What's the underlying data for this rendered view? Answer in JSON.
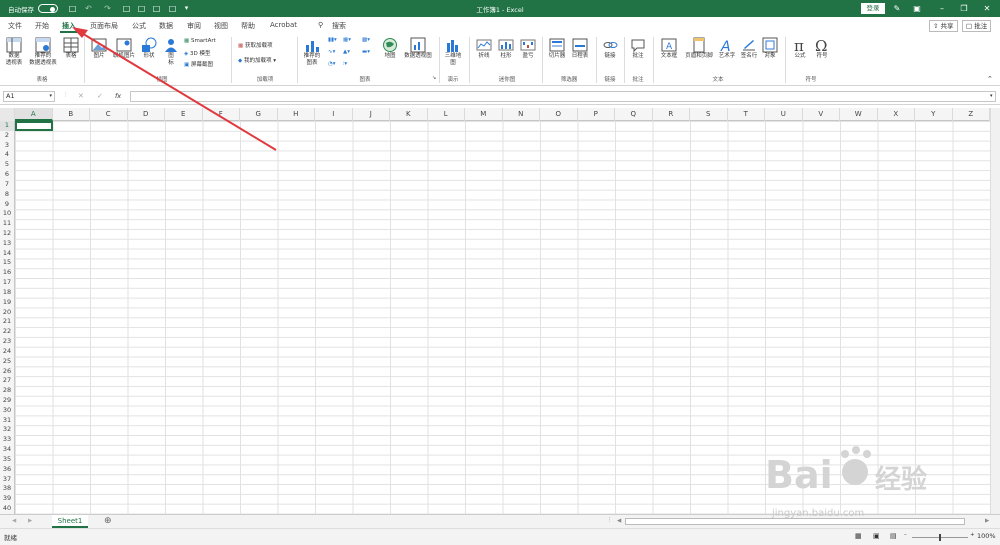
{
  "titlebar": {
    "autosave_label": "自动保存",
    "doc_title": "工作簿1 - Excel",
    "login": "登录"
  },
  "tabs": [
    "文件",
    "开始",
    "插入",
    "页面布局",
    "公式",
    "数据",
    "审阅",
    "视图",
    "帮助",
    "Acrobat",
    "搜索"
  ],
  "share": {
    "share": "共享",
    "comment": "批注"
  },
  "ribbon": {
    "pivot": "数据\n透视表",
    "rec_pivot": "推荐的\n数据透视表",
    "table": "表格",
    "grp_table": "表格",
    "picture": "图片",
    "online_picture": "联机图片",
    "shapes": "形状",
    "icons": "图\n标",
    "smartart": "SmartArt",
    "model3d": "3D 模型",
    "screenshot": "屏幕截图",
    "grp_illus": "插图",
    "get_addins": "获取加载项",
    "my_addins": "我的加载项",
    "grp_addins": "加载项",
    "rec_charts": "推荐的\n图表",
    "maps": "地图",
    "pivotchart": "数据透视图",
    "grp_charts": "图表",
    "map3d": "三维地\n图",
    "grp_tours": "演示",
    "line": "折线",
    "column": "柱形",
    "winloss": "盈亏",
    "grp_spark": "迷你图",
    "slicer": "切片器",
    "timeline": "日程表",
    "grp_filter": "筛选器",
    "link": "链接",
    "grp_link": "链接",
    "comment": "批注",
    "grp_comment": "批注",
    "textbox": "文本框",
    "header": "页眉和页脚",
    "wordart": "艺术字",
    "signature": "签名行",
    "object": "对象",
    "grp_text": "文本",
    "equation": "公式",
    "symbol": "符号",
    "grp_symbol": "符号"
  },
  "namebox": "A1",
  "fx": "fx",
  "columns": [
    "A",
    "B",
    "C",
    "D",
    "E",
    "F",
    "G",
    "H",
    "I",
    "J",
    "K",
    "L",
    "M",
    "N",
    "O",
    "P",
    "Q",
    "R",
    "S",
    "T",
    "U",
    "V",
    "W",
    "X",
    "Y",
    "Z"
  ],
  "rows": [
    "1",
    "2",
    "3",
    "4",
    "5",
    "6",
    "7",
    "8",
    "9",
    "10",
    "11",
    "12",
    "13",
    "14",
    "15",
    "16",
    "17",
    "18",
    "19",
    "20",
    "21",
    "22",
    "23",
    "24",
    "25",
    "26",
    "27",
    "28",
    "29",
    "30",
    "31",
    "32",
    "33",
    "34",
    "35",
    "36",
    "37",
    "38",
    "39",
    "40"
  ],
  "sheet_tab": "Sheet1",
  "status": "就绪",
  "zoom": "100%",
  "watermark": {
    "brand": "Bai",
    "brand2": "经验",
    "url": "jingyan.baidu.com"
  },
  "colors": {
    "excel_green": "#217346",
    "arrow_red": "#e0393e"
  }
}
